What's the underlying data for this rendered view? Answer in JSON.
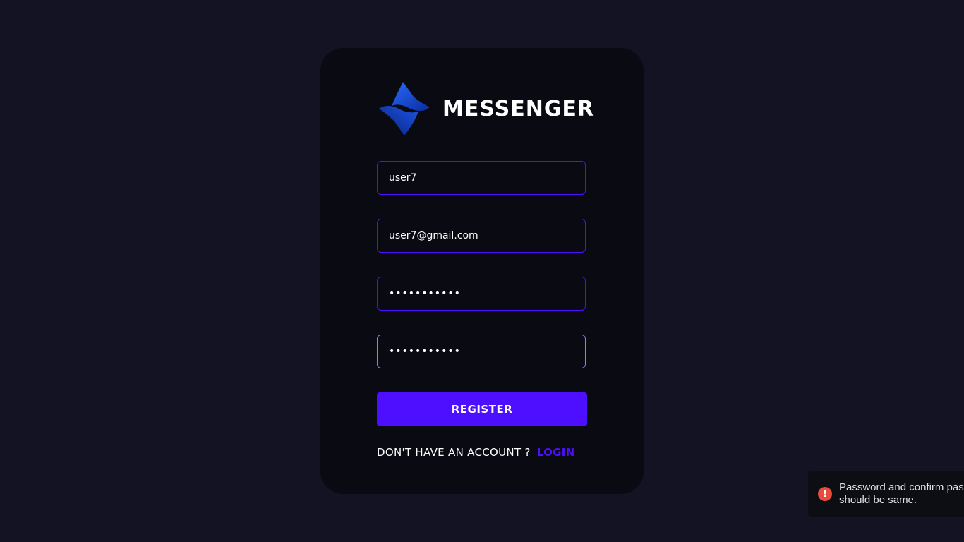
{
  "brand": {
    "title": "MESSENGER",
    "logo_icon": "messenger-logo-icon",
    "accent_color": "#4e0eff"
  },
  "form": {
    "username_value": "user7",
    "email_value": "user7@gmail.com",
    "password_masked": "•••••••••••",
    "confirm_password_masked": "•••••••••••",
    "register_label": "REGISTER",
    "switch_prompt": "DON'T HAVE AN ACCOUNT ?",
    "switch_link": "LOGIN"
  },
  "toast": {
    "icon": "error-icon",
    "message": "Password and confirm password should be same.",
    "status_color": "#e74c3c"
  }
}
